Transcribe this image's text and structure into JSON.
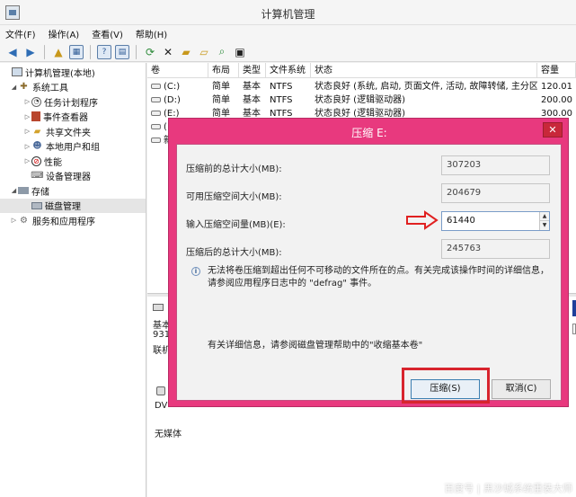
{
  "window": {
    "title": "计算机管理"
  },
  "menu": [
    "文件(F)",
    "操作(A)",
    "查看(V)",
    "帮助(H)"
  ],
  "toolbar": {
    "icons": [
      "back-icon",
      "forward-icon",
      "up-folder-icon",
      "show-hide-tree-icon",
      "help-icon",
      "properties-icon",
      "refresh-icon",
      "delete-icon",
      "open-folder-icon",
      "open-icon",
      "search-icon",
      "properties-sheet-icon"
    ]
  },
  "tree": [
    {
      "label": "计算机管理(本地)",
      "level": 0,
      "twisty": "",
      "icon": "computer-icon"
    },
    {
      "label": "系统工具",
      "level": 1,
      "twisty": "◢",
      "icon": "tools-icon"
    },
    {
      "label": "任务计划程序",
      "level": 2,
      "twisty": "▷",
      "icon": "clock-icon"
    },
    {
      "label": "事件查看器",
      "level": 2,
      "twisty": "▷",
      "icon": "event-viewer-icon"
    },
    {
      "label": "共享文件夹",
      "level": 2,
      "twisty": "▷",
      "icon": "shared-folder-icon"
    },
    {
      "label": "本地用户和组",
      "level": 2,
      "twisty": "▷",
      "icon": "users-icon"
    },
    {
      "label": "性能",
      "level": 2,
      "twisty": "▷",
      "icon": "performance-icon"
    },
    {
      "label": "设备管理器",
      "level": 2,
      "twisty": "",
      "icon": "device-manager-icon"
    },
    {
      "label": "存储",
      "level": 1,
      "twisty": "◢",
      "icon": "storage-icon"
    },
    {
      "label": "磁盘管理",
      "level": 2,
      "twisty": "",
      "icon": "disk-management-icon",
      "selected": true
    },
    {
      "label": "服务和应用程序",
      "level": 1,
      "twisty": "▷",
      "icon": "services-icon"
    }
  ],
  "volumes": {
    "headers": [
      "卷",
      "布局",
      "类型",
      "文件系统",
      "状态",
      "容量"
    ],
    "rows": [
      [
        "(C:)",
        "简单",
        "基本",
        "NTFS",
        "状态良好 (系统, 启动, 页面文件, 活动, 故障转储, 主分区)",
        "120.01"
      ],
      [
        "(D:)",
        "简单",
        "基本",
        "NTFS",
        "状态良好 (逻辑驱动器)",
        "200.00"
      ],
      [
        "(E:)",
        "简单",
        "基本",
        "NTFS",
        "状态良好 (逻辑驱动器)",
        "300.00"
      ],
      [
        "(",
        "",
        "",
        "",
        "",
        ""
      ],
      [
        "新",
        "",
        "",
        "",
        "",
        ""
      ]
    ]
  },
  "lower": {
    "disk_line1": "基本",
    "disk_line2": "931",
    "disk_line3": "联机",
    "dvd_label": "DV",
    "no_media": "无媒体"
  },
  "dialog": {
    "title": "压缩 E:",
    "close": "✕",
    "fields": [
      {
        "label": "压缩前的总计大小(MB):",
        "value": "307203"
      },
      {
        "label": "可用压缩空间大小(MB):",
        "value": "204679"
      },
      {
        "label": "输入压缩空间量(MB)(E):",
        "value": "61440"
      },
      {
        "label": "压缩后的总计大小(MB):",
        "value": "245763"
      }
    ],
    "info_text": "无法将卷压缩到超出任何不可移动的文件所在的点。有关完成该操作时间的详细信息，请参阅应用程序日志中的 \"defrag\" 事件。",
    "help_text": "有关详细信息，请参阅磁盘管理帮助中的\"收缩基本卷\"",
    "ok_label": "压缩(S)",
    "cancel_label": "取消(C)"
  },
  "watermark": "百度号 | 黑沙城系统重装大师",
  "colors": {
    "dialog_frame": "#e8397e",
    "highlight": "#d8242d"
  }
}
